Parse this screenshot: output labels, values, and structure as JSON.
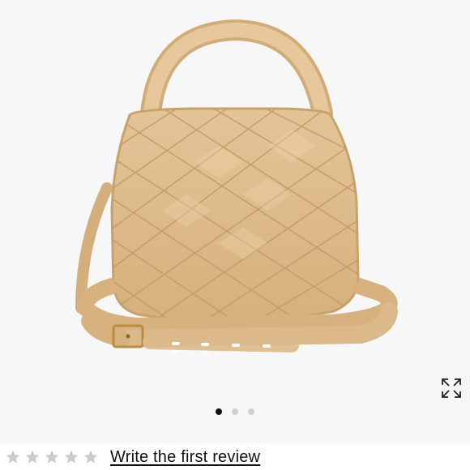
{
  "product": {
    "image_subject": "woven-leather-crossbody-bag",
    "bag_color": "#dcb98a"
  },
  "gallery": {
    "slide_count": 3,
    "active_index": 0,
    "expand_icon": "expand-arrows-icon"
  },
  "reviews": {
    "rating": 0,
    "max_rating": 5,
    "star_color": "#cccccc",
    "cta_label": "Write the first review"
  }
}
